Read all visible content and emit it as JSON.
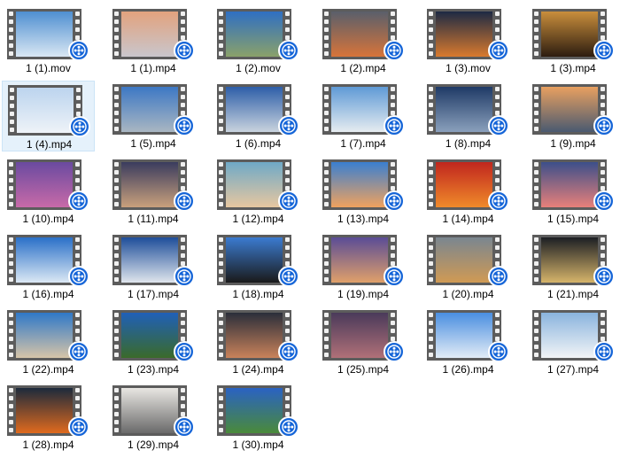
{
  "files": [
    {
      "name": "1 (1).mov",
      "thumb": [
        "#4f8fd1",
        "#d9e7f3"
      ],
      "badge_icon": "film-reel-icon"
    },
    {
      "name": "1 (1).mp4",
      "thumb": [
        "#e2a27e",
        "#c9c6cc"
      ],
      "badge_icon": "film-reel-icon"
    },
    {
      "name": "1 (2).mov",
      "thumb": [
        "#2f6fc2",
        "#8aa16a"
      ],
      "badge_icon": "film-reel-icon"
    },
    {
      "name": "1 (2).mp4",
      "thumb": [
        "#5a5f6b",
        "#d7743a"
      ],
      "badge_icon": "film-reel-icon"
    },
    {
      "name": "1 (3).mov",
      "thumb": [
        "#1d2a44",
        "#d97a2e"
      ],
      "badge_icon": "film-reel-icon"
    },
    {
      "name": "1 (3).mp4",
      "thumb": [
        "#c98e3c",
        "#2d1d10"
      ],
      "badge_icon": "film-reel-icon"
    },
    {
      "name": "1 (4).mp4",
      "thumb": [
        "#bcd4ee",
        "#eef3f8"
      ],
      "badge_icon": "film-reel-icon"
    },
    {
      "name": "1 (5).mp4",
      "thumb": [
        "#3d78c4",
        "#a9b6c2"
      ],
      "badge_icon": "film-reel-icon"
    },
    {
      "name": "1 (6).mp4",
      "thumb": [
        "#2d5ea8",
        "#c9d3de"
      ],
      "badge_icon": "film-reel-icon"
    },
    {
      "name": "1 (7).mp4",
      "thumb": [
        "#5f9ad6",
        "#e6ecf0"
      ],
      "badge_icon": "film-reel-icon"
    },
    {
      "name": "1 (8).mp4",
      "thumb": [
        "#1f3a66",
        "#8aa0bc"
      ],
      "badge_icon": "film-reel-icon"
    },
    {
      "name": "1 (9).mp4",
      "thumb": [
        "#e8a060",
        "#4a5a70"
      ],
      "badge_icon": "film-reel-icon"
    },
    {
      "name": "1 (10).mp4",
      "thumb": [
        "#6a4aa0",
        "#c86aa8"
      ],
      "badge_icon": "film-reel-icon"
    },
    {
      "name": "1 (11).mp4",
      "thumb": [
        "#3a3c5e",
        "#c9a07c"
      ],
      "badge_icon": "film-reel-icon"
    },
    {
      "name": "1 (12).mp4",
      "thumb": [
        "#6fa9c7",
        "#e7c7a0"
      ],
      "badge_icon": "film-reel-icon"
    },
    {
      "name": "1 (13).mp4",
      "thumb": [
        "#3a7fd0",
        "#f0a25e"
      ],
      "badge_icon": "film-reel-icon"
    },
    {
      "name": "1 (14).mp4",
      "thumb": [
        "#c0261e",
        "#f08a2a"
      ],
      "badge_icon": "film-reel-icon"
    },
    {
      "name": "1 (15).mp4",
      "thumb": [
        "#3c4f8a",
        "#e8807a"
      ],
      "badge_icon": "film-reel-icon"
    },
    {
      "name": "1 (16).mp4",
      "thumb": [
        "#2a70c8",
        "#dbe8f4"
      ],
      "badge_icon": "film-reel-icon"
    },
    {
      "name": "1 (17).mp4",
      "thumb": [
        "#1e4e9a",
        "#dfe5ec"
      ],
      "badge_icon": "film-reel-icon"
    },
    {
      "name": "1 (18).mp4",
      "thumb": [
        "#3b7bd0",
        "#1a1a1a"
      ],
      "badge_icon": "film-reel-icon"
    },
    {
      "name": "1 (19).mp4",
      "thumb": [
        "#5a4c96",
        "#e0a06a"
      ],
      "badge_icon": "film-reel-icon"
    },
    {
      "name": "1 (20).mp4",
      "thumb": [
        "#7a8690",
        "#d09a54"
      ],
      "badge_icon": "film-reel-icon"
    },
    {
      "name": "1 (21).mp4",
      "thumb": [
        "#1c1f24",
        "#d6b46a"
      ],
      "badge_icon": "film-reel-icon"
    },
    {
      "name": "1 (22).mp4",
      "thumb": [
        "#2f78c8",
        "#d6c4a8"
      ],
      "badge_icon": "film-reel-icon"
    },
    {
      "name": "1 (23).mp4",
      "thumb": [
        "#2060b8",
        "#3a6a2a"
      ],
      "badge_icon": "film-reel-icon"
    },
    {
      "name": "1 (24).mp4",
      "thumb": [
        "#2a2e3a",
        "#c9825a"
      ],
      "badge_icon": "film-reel-icon"
    },
    {
      "name": "1 (25).mp4",
      "thumb": [
        "#4a3a5a",
        "#b07078"
      ],
      "badge_icon": "film-reel-icon"
    },
    {
      "name": "1 (26).mp4",
      "thumb": [
        "#4a8ee0",
        "#e2ecf6"
      ],
      "badge_icon": "film-reel-icon"
    },
    {
      "name": "1 (27).mp4",
      "thumb": [
        "#8ab4de",
        "#f2f4f6"
      ],
      "badge_icon": "film-reel-icon"
    },
    {
      "name": "1 (28).mp4",
      "thumb": [
        "#1c2a3c",
        "#e06a1e"
      ],
      "badge_icon": "film-reel-icon"
    },
    {
      "name": "1 (29).mp4",
      "thumb": [
        "#e8e6e2",
        "#6a6a6a"
      ],
      "badge_icon": "film-reel-icon"
    },
    {
      "name": "1 (30).mp4",
      "thumb": [
        "#2a62c2",
        "#4a8a3a"
      ],
      "badge_icon": "film-reel-icon"
    }
  ],
  "selected_index": 6,
  "colors": {
    "selection": "#e5f1fb",
    "badge": "#1565d8",
    "filmstrip": "#5c5c5c"
  }
}
